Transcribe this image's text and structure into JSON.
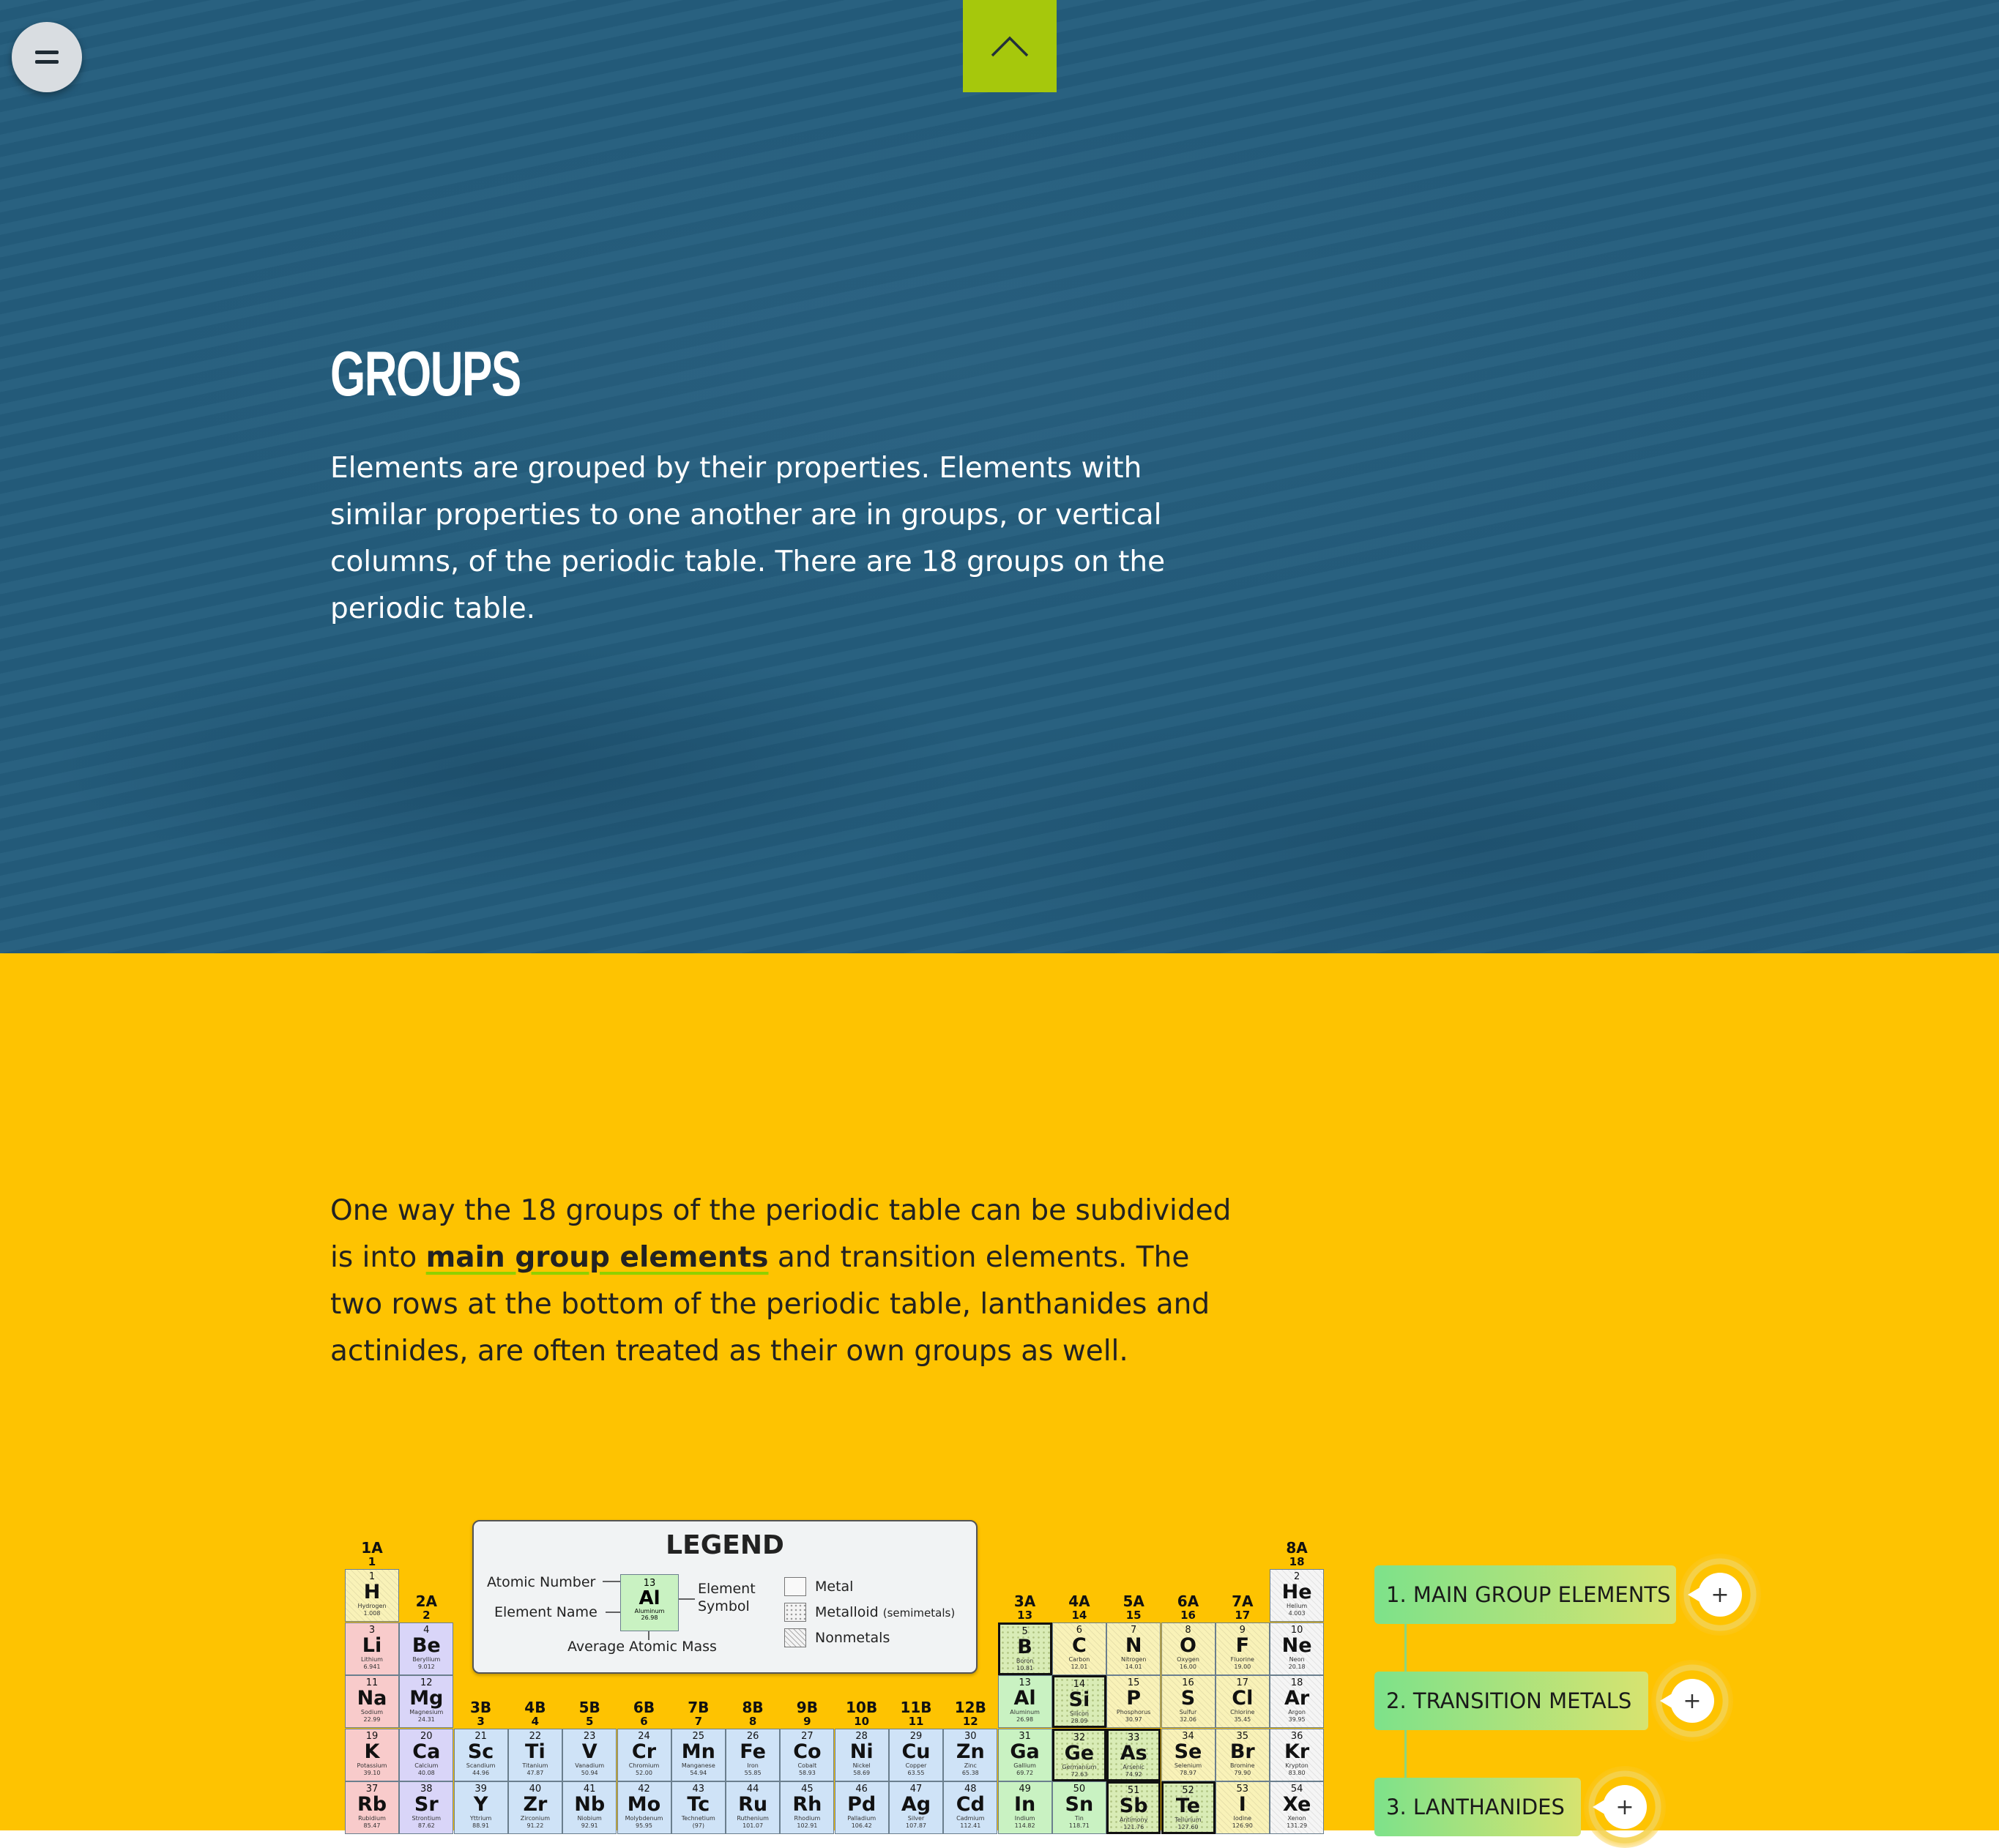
{
  "hero": {
    "title": "GROUPS",
    "text": "Elements are grouped by their properties. Elements with similar properties to one another are in groups, or vertical columns, of the periodic table. There are 18 groups on the periodic table."
  },
  "intro": {
    "pre": "One way the 18 groups of the periodic table can be subdivided is into ",
    "link": "main group elements",
    "post": " and transition elements. The two rows at the bottom of the periodic table, lanthanides and actinides, are often treated as their own groups as well."
  },
  "legend": {
    "title": "LEGEND",
    "atomic_number": "Atomic Number",
    "element_name": "Element Name",
    "element_symbol": "Element Symbol",
    "average_mass": "Average Atomic Mass",
    "sample": {
      "number": "13",
      "symbol": "Al",
      "name": "Aluminum",
      "mass": "26.98"
    },
    "metal": "Metal",
    "metalloid": "Metalloid",
    "metalloid_note": "(semimetals)",
    "nonmetals": "Nonmetals"
  },
  "groups": [
    {
      "a": "1A",
      "n": "1"
    },
    {
      "a": "2A",
      "n": "2"
    },
    {
      "a": "3B",
      "n": "3"
    },
    {
      "a": "4B",
      "n": "4"
    },
    {
      "a": "5B",
      "n": "5"
    },
    {
      "a": "6B",
      "n": "6"
    },
    {
      "a": "7B",
      "n": "7"
    },
    {
      "a": "8B",
      "n": "8"
    },
    {
      "a": "9B",
      "n": "9"
    },
    {
      "a": "10B",
      "n": "10"
    },
    {
      "a": "11B",
      "n": "11"
    },
    {
      "a": "12B",
      "n": "12"
    },
    {
      "a": "3A",
      "n": "13"
    },
    {
      "a": "4A",
      "n": "14"
    },
    {
      "a": "5A",
      "n": "15"
    },
    {
      "a": "6A",
      "n": "16"
    },
    {
      "a": "7A",
      "n": "17"
    },
    {
      "a": "8A",
      "n": "18"
    }
  ],
  "elements": [
    {
      "n": "1",
      "s": "H",
      "name": "Hydrogen",
      "m": "1.008",
      "col": 0,
      "row": 0,
      "cat": "nonmetal-h"
    },
    {
      "n": "2",
      "s": "He",
      "name": "Helium",
      "m": "4.003",
      "col": 17,
      "row": 0,
      "cat": "noble"
    },
    {
      "n": "3",
      "s": "Li",
      "name": "Lithium",
      "m": "6.941",
      "col": 0,
      "row": 1,
      "cat": "alkali"
    },
    {
      "n": "4",
      "s": "Be",
      "name": "Beryllium",
      "m": "9.012",
      "col": 1,
      "row": 1,
      "cat": "alkaline"
    },
    {
      "n": "5",
      "s": "B",
      "name": "Boron",
      "m": "10.81",
      "col": 12,
      "row": 1,
      "cat": "metalloid"
    },
    {
      "n": "6",
      "s": "C",
      "name": "Carbon",
      "m": "12.01",
      "col": 13,
      "row": 1,
      "cat": "nonmetal"
    },
    {
      "n": "7",
      "s": "N",
      "name": "Nitrogen",
      "m": "14.01",
      "col": 14,
      "row": 1,
      "cat": "nonmetal"
    },
    {
      "n": "8",
      "s": "O",
      "name": "Oxygen",
      "m": "16.00",
      "col": 15,
      "row": 1,
      "cat": "nonmetal"
    },
    {
      "n": "9",
      "s": "F",
      "name": "Fluorine",
      "m": "19.00",
      "col": 16,
      "row": 1,
      "cat": "nonmetal"
    },
    {
      "n": "10",
      "s": "Ne",
      "name": "Neon",
      "m": "20.18",
      "col": 17,
      "row": 1,
      "cat": "noble"
    },
    {
      "n": "11",
      "s": "Na",
      "name": "Sodium",
      "m": "22.99",
      "col": 0,
      "row": 2,
      "cat": "alkali"
    },
    {
      "n": "12",
      "s": "Mg",
      "name": "Magnesium",
      "m": "24.31",
      "col": 1,
      "row": 2,
      "cat": "alkaline"
    },
    {
      "n": "13",
      "s": "Al",
      "name": "Aluminum",
      "m": "26.98",
      "col": 12,
      "row": 2,
      "cat": "post"
    },
    {
      "n": "14",
      "s": "Si",
      "name": "Silicon",
      "m": "28.09",
      "col": 13,
      "row": 2,
      "cat": "metalloid"
    },
    {
      "n": "15",
      "s": "P",
      "name": "Phosphorus",
      "m": "30.97",
      "col": 14,
      "row": 2,
      "cat": "nonmetal"
    },
    {
      "n": "16",
      "s": "S",
      "name": "Sulfur",
      "m": "32.06",
      "col": 15,
      "row": 2,
      "cat": "nonmetal"
    },
    {
      "n": "17",
      "s": "Cl",
      "name": "Chlorine",
      "m": "35.45",
      "col": 16,
      "row": 2,
      "cat": "nonmetal"
    },
    {
      "n": "18",
      "s": "Ar",
      "name": "Argon",
      "m": "39.95",
      "col": 17,
      "row": 2,
      "cat": "noble"
    },
    {
      "n": "19",
      "s": "K",
      "name": "Potassium",
      "m": "39.10",
      "col": 0,
      "row": 3,
      "cat": "alkali"
    },
    {
      "n": "20",
      "s": "Ca",
      "name": "Calcium",
      "m": "40.08",
      "col": 1,
      "row": 3,
      "cat": "alkaline"
    },
    {
      "n": "21",
      "s": "Sc",
      "name": "Scandium",
      "m": "44.96",
      "col": 2,
      "row": 3,
      "cat": "transition"
    },
    {
      "n": "22",
      "s": "Ti",
      "name": "Titanium",
      "m": "47.87",
      "col": 3,
      "row": 3,
      "cat": "transition"
    },
    {
      "n": "23",
      "s": "V",
      "name": "Vanadium",
      "m": "50.94",
      "col": 4,
      "row": 3,
      "cat": "transition"
    },
    {
      "n": "24",
      "s": "Cr",
      "name": "Chromium",
      "m": "52.00",
      "col": 5,
      "row": 3,
      "cat": "transition"
    },
    {
      "n": "25",
      "s": "Mn",
      "name": "Manganese",
      "m": "54.94",
      "col": 6,
      "row": 3,
      "cat": "transition"
    },
    {
      "n": "26",
      "s": "Fe",
      "name": "Iron",
      "m": "55.85",
      "col": 7,
      "row": 3,
      "cat": "transition"
    },
    {
      "n": "27",
      "s": "Co",
      "name": "Cobalt",
      "m": "58.93",
      "col": 8,
      "row": 3,
      "cat": "transition"
    },
    {
      "n": "28",
      "s": "Ni",
      "name": "Nickel",
      "m": "58.69",
      "col": 9,
      "row": 3,
      "cat": "transition"
    },
    {
      "n": "29",
      "s": "Cu",
      "name": "Copper",
      "m": "63.55",
      "col": 10,
      "row": 3,
      "cat": "transition"
    },
    {
      "n": "30",
      "s": "Zn",
      "name": "Zinc",
      "m": "65.38",
      "col": 11,
      "row": 3,
      "cat": "transition"
    },
    {
      "n": "31",
      "s": "Ga",
      "name": "Gallium",
      "m": "69.72",
      "col": 12,
      "row": 3,
      "cat": "post"
    },
    {
      "n": "32",
      "s": "Ge",
      "name": "Germanium",
      "m": "72.63",
      "col": 13,
      "row": 3,
      "cat": "metalloid"
    },
    {
      "n": "33",
      "s": "As",
      "name": "Arsenic",
      "m": "74.92",
      "col": 14,
      "row": 3,
      "cat": "metalloid"
    },
    {
      "n": "34",
      "s": "Se",
      "name": "Selenium",
      "m": "78.97",
      "col": 15,
      "row": 3,
      "cat": "nonmetal"
    },
    {
      "n": "35",
      "s": "Br",
      "name": "Bromine",
      "m": "79.90",
      "col": 16,
      "row": 3,
      "cat": "nonmetal"
    },
    {
      "n": "36",
      "s": "Kr",
      "name": "Krypton",
      "m": "83.80",
      "col": 17,
      "row": 3,
      "cat": "noble"
    },
    {
      "n": "37",
      "s": "Rb",
      "name": "Rubidium",
      "m": "85.47",
      "col": 0,
      "row": 4,
      "cat": "alkali"
    },
    {
      "n": "38",
      "s": "Sr",
      "name": "Strontium",
      "m": "87.62",
      "col": 1,
      "row": 4,
      "cat": "alkaline"
    },
    {
      "n": "39",
      "s": "Y",
      "name": "Yttrium",
      "m": "88.91",
      "col": 2,
      "row": 4,
      "cat": "transition"
    },
    {
      "n": "40",
      "s": "Zr",
      "name": "Zirconium",
      "m": "91.22",
      "col": 3,
      "row": 4,
      "cat": "transition"
    },
    {
      "n": "41",
      "s": "Nb",
      "name": "Niobium",
      "m": "92.91",
      "col": 4,
      "row": 4,
      "cat": "transition"
    },
    {
      "n": "42",
      "s": "Mo",
      "name": "Molybdenum",
      "m": "95.95",
      "col": 5,
      "row": 4,
      "cat": "transition"
    },
    {
      "n": "43",
      "s": "Tc",
      "name": "Technetium",
      "m": "(97)",
      "col": 6,
      "row": 4,
      "cat": "transition"
    },
    {
      "n": "44",
      "s": "Ru",
      "name": "Ruthenium",
      "m": "101.07",
      "col": 7,
      "row": 4,
      "cat": "transition"
    },
    {
      "n": "45",
      "s": "Rh",
      "name": "Rhodium",
      "m": "102.91",
      "col": 8,
      "row": 4,
      "cat": "transition"
    },
    {
      "n": "46",
      "s": "Pd",
      "name": "Palladium",
      "m": "106.42",
      "col": 9,
      "row": 4,
      "cat": "transition"
    },
    {
      "n": "47",
      "s": "Ag",
      "name": "Silver",
      "m": "107.87",
      "col": 10,
      "row": 4,
      "cat": "transition"
    },
    {
      "n": "48",
      "s": "Cd",
      "name": "Cadmium",
      "m": "112.41",
      "col": 11,
      "row": 4,
      "cat": "transition"
    },
    {
      "n": "49",
      "s": "In",
      "name": "Indium",
      "m": "114.82",
      "col": 12,
      "row": 4,
      "cat": "post"
    },
    {
      "n": "50",
      "s": "Sn",
      "name": "Tin",
      "m": "118.71",
      "col": 13,
      "row": 4,
      "cat": "post"
    },
    {
      "n": "51",
      "s": "Sb",
      "name": "Antimony",
      "m": "121.76",
      "col": 14,
      "row": 4,
      "cat": "metalloid"
    },
    {
      "n": "52",
      "s": "Te",
      "name": "Tellurium",
      "m": "127.60",
      "col": 15,
      "row": 4,
      "cat": "metalloid"
    },
    {
      "n": "53",
      "s": "I",
      "name": "Iodine",
      "m": "126.90",
      "col": 16,
      "row": 4,
      "cat": "nonmetal"
    },
    {
      "n": "54",
      "s": "Xe",
      "name": "Xenon",
      "m": "131.29",
      "col": 17,
      "row": 4,
      "cat": "noble"
    }
  ],
  "categories": [
    {
      "label": "1. MAIN GROUP ELEMENTS",
      "color_from": "#7de28a",
      "color_to": "#d7e370"
    },
    {
      "label": "2. TRANSITION METALS",
      "color_from": "#7de28a",
      "color_to": "#d7e370"
    },
    {
      "label": "3. LANTHANIDES",
      "color_from": "#7de28a",
      "color_to": "#d7e370"
    }
  ],
  "colors": {
    "hero_bg": "#245d7d",
    "section_bg": "#fec301",
    "top_button": "#a6c80c",
    "link_underline": "#8fd000",
    "alkali": "#f8cbcb",
    "alkaline": "#d9d5f8",
    "transition": "#cfe3f7",
    "post": "#c9f2c2",
    "metalloid": "#d9ecb6",
    "nonmetal": "#f9f2b8",
    "nonmetal-h": "#f9f2b8",
    "noble": "#f5f5f5"
  },
  "icons": {
    "menu": "menu-icon",
    "scroll_top": "chevron-up-icon",
    "expand": "plus-icon"
  }
}
